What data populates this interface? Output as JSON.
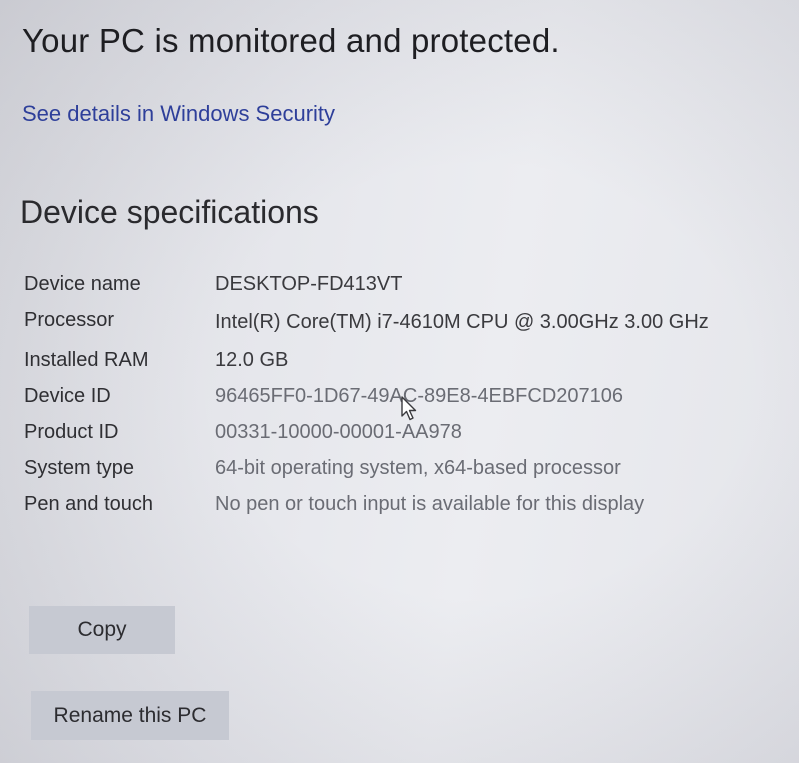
{
  "protection": {
    "title": "Your PC is monitored and protected.",
    "link": "See details in Windows Security"
  },
  "device_specs": {
    "title": "Device specifications",
    "rows": [
      {
        "label": "Device name",
        "value": "DESKTOP-FD413VT"
      },
      {
        "label": "Processor",
        "value": "Intel(R) Core(TM) i7-4610M CPU @ 3.00GHz   3.00 GHz"
      },
      {
        "label": "Installed RAM",
        "value": "12.0 GB"
      },
      {
        "label": "Device ID",
        "value": "96465FF0-1D67-49AC-89E8-4EBFCD207106"
      },
      {
        "label": "Product ID",
        "value": "00331-10000-00001-AA978"
      },
      {
        "label": "System type",
        "value": "64-bit operating system, x64-based processor"
      },
      {
        "label": "Pen and touch",
        "value": "No pen or touch input is available for this display"
      }
    ],
    "copy_label": "Copy",
    "rename_label": "Rename this PC"
  }
}
